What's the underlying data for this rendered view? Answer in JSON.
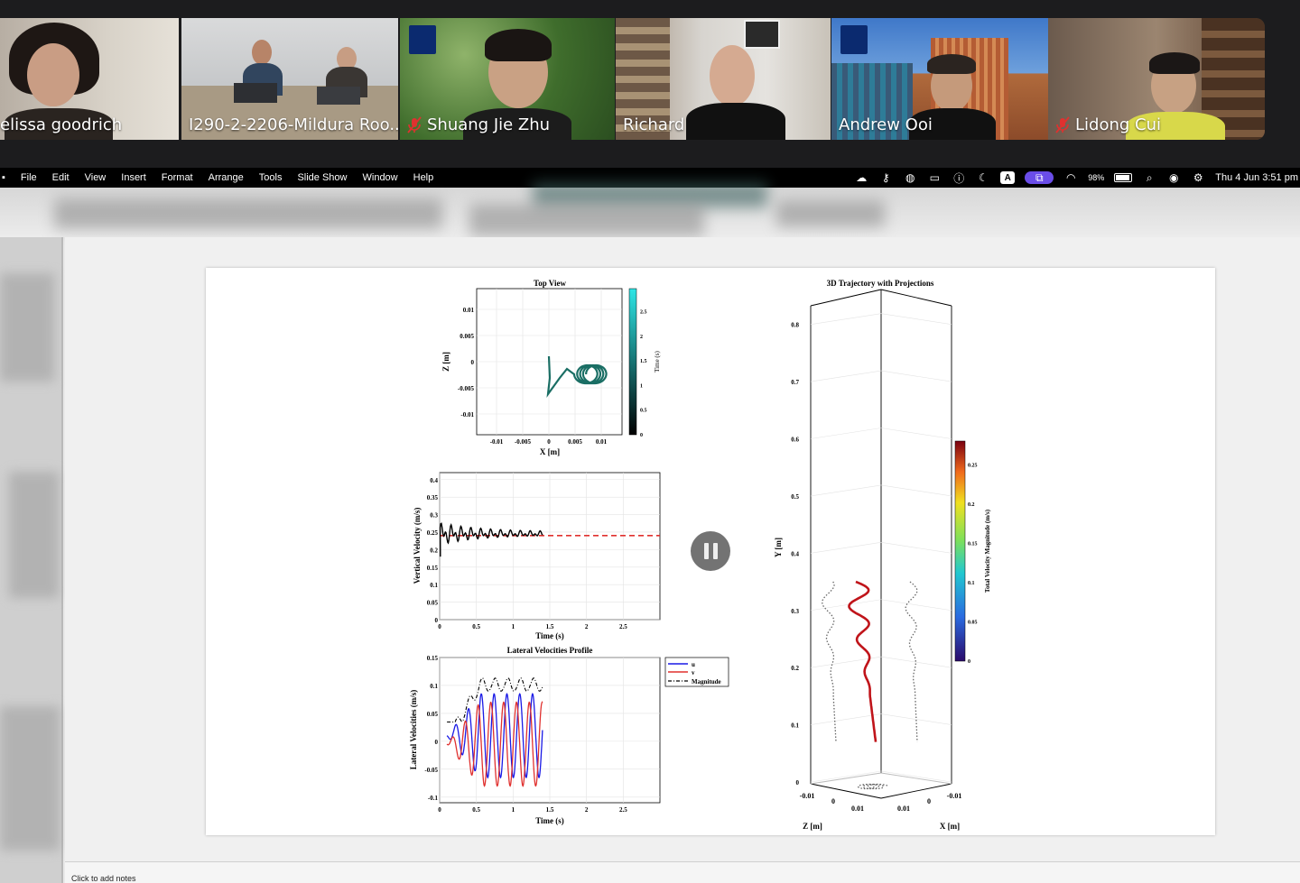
{
  "participants": [
    {
      "name": "elissa goodrich",
      "muted": false,
      "active": false
    },
    {
      "name": "I290-2-2206-Mildura Roo...",
      "muted": false,
      "active": true
    },
    {
      "name": "Shuang Jie Zhu",
      "muted": true,
      "active": false
    },
    {
      "name": "Richard",
      "muted": false,
      "active": false
    },
    {
      "name": "Andrew Ooi",
      "muted": false,
      "active": false
    },
    {
      "name": "Lidong Cui",
      "muted": true,
      "active": false
    }
  ],
  "menubar": {
    "items": [
      "File",
      "Edit",
      "View",
      "Insert",
      "Format",
      "Arrange",
      "Tools",
      "Slide Show",
      "Window",
      "Help"
    ],
    "battery": "98%",
    "clock": "Thu 4 Jun  3:51 pm"
  },
  "notes_placeholder": "Click to add notes",
  "colors": {
    "active_border": "#27c93f",
    "mic_muted": "#e0312f",
    "slide_bg": "#ffffff"
  },
  "chart_data": [
    {
      "type": "line",
      "title": "Top View",
      "xlabel": "X [m]",
      "ylabel": "Z [m]",
      "xticks": [
        "-0.01",
        "-0.005",
        "0",
        "0.005",
        "0.01"
      ],
      "yticks": [
        "0.01",
        "0.005",
        "0",
        "-0.005",
        "-0.01"
      ],
      "colorbar": {
        "label": "Time (s)",
        "ticks": [
          "0",
          "0.5",
          "1",
          "1.5",
          "2",
          "2.5"
        ]
      }
    },
    {
      "type": "line",
      "title": "",
      "xlabel": "Time (s)",
      "ylabel": "Vertical Velocity (m/s)",
      "xticks": [
        "0",
        "0.5",
        "1",
        "1.5",
        "2",
        "2.5"
      ],
      "yticks": [
        "0",
        "0.05",
        "0.1",
        "0.15",
        "0.2",
        "0.25",
        "0.3",
        "0.35",
        "0.4"
      ],
      "reference_line": 0.24,
      "series_summary": {
        "mean_value": 0.245,
        "time_end": 1.4
      }
    },
    {
      "type": "line",
      "title": "Lateral Velocities Profile",
      "xlabel": "Time (s)",
      "ylabel": "Lateral Velocities (m/s)",
      "xticks": [
        "0",
        "0.5",
        "1",
        "1.5",
        "2",
        "2.5"
      ],
      "yticks": [
        "0.15",
        "0.1",
        "0.05",
        "0",
        "-0.05",
        "-0.1"
      ],
      "legend": [
        "u",
        "v",
        "Magnitude"
      ]
    },
    {
      "type": "line",
      "title": "3D Trajectory with Projections",
      "xlabel": "X [m]",
      "ylabel": "Y [m]",
      "zlabel": "Z [m]",
      "yticks": [
        "0",
        "0.1",
        "0.2",
        "0.3",
        "0.4",
        "0.5",
        "0.6",
        "0.7",
        "0.8"
      ],
      "xticks": [
        "-0.01",
        "0",
        "0.01"
      ],
      "zticks": [
        "-0.01",
        "0",
        "0.01"
      ],
      "colorbar": {
        "label": "Total Velocity Magnitude (m/s)",
        "ticks": [
          "0",
          "0.05",
          "0.1",
          "0.15",
          "0.2",
          "0.25"
        ]
      }
    }
  ]
}
